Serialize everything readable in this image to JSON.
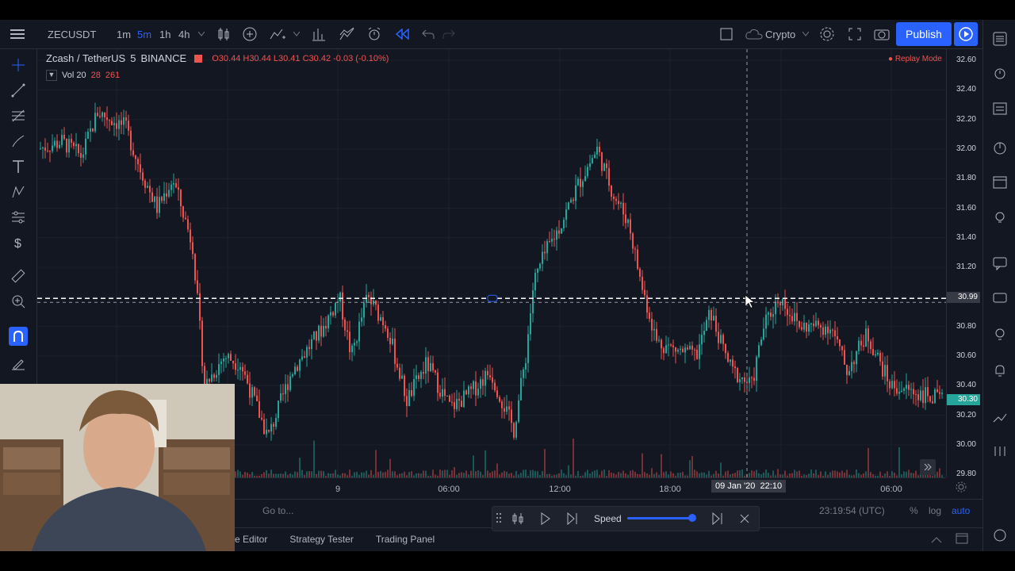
{
  "toolbar": {
    "symbol": "ZECUSDT",
    "intervals": [
      "1m",
      "5m",
      "1h",
      "4h"
    ],
    "active_interval": "5m",
    "market": "Crypto",
    "publish_label": "Publish"
  },
  "legend": {
    "title": "Zcash / TetherUS",
    "interval": "5",
    "exchange": "BINANCE",
    "ohlc": "O30.44 H30.44 L30.41 C30.42 -0.03 (-0.10%)",
    "vol_label": "Vol 20",
    "vol_a": "28",
    "vol_b": "261",
    "replay_mode": "Replay Mode"
  },
  "price_scale": {
    "labels": [
      "32.60",
      "32.40",
      "32.20",
      "32.00",
      "31.80",
      "31.60",
      "31.40",
      "31.20",
      "30.80",
      "30.60",
      "30.40",
      "30.20",
      "30.00",
      "29.80"
    ],
    "crosshair_price": "30.99",
    "last_price": "30.30"
  },
  "time_axis": {
    "labels": [
      "9",
      "06:00",
      "12:00",
      "18:00",
      "06:00"
    ],
    "crosshair_time": "09 Jan '20  22:10"
  },
  "bottom": {
    "goto": "Go to...",
    "clock": "23:19:54 (UTC)",
    "percent": "%",
    "log": "log",
    "auto": "auto"
  },
  "replay": {
    "speed_label": "Speed",
    "speed_level": 0.95
  },
  "tabs": [
    "e Editor",
    "Strategy Tester",
    "Trading Panel"
  ],
  "colors": {
    "bg": "#131722",
    "up": "#26a69a",
    "down": "#ef5350",
    "accent": "#2962ff"
  }
}
